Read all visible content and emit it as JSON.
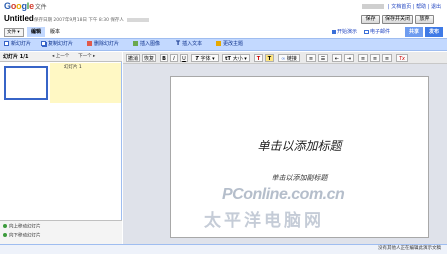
{
  "app": {
    "logo_google": "Google",
    "logo_product": "文件",
    "top_links": [
      "|",
      "文档首页",
      "|",
      "帮助",
      "|",
      "退出"
    ]
  },
  "doc": {
    "title": "Untitled",
    "save_info": "保存日期 2007年9月18日 下午 8:30 保存人"
  },
  "top_buttons": {
    "save": "保存",
    "save_close": "保存并关闭",
    "discard": "放弃"
  },
  "menu": {
    "file": "文件 ▾",
    "tabs": [
      {
        "label": "编辑"
      },
      {
        "label": "版本"
      }
    ],
    "right_items": [
      "开始演示",
      "电子邮件"
    ],
    "share": "共享",
    "publish": "发布"
  },
  "toolbar1": [
    {
      "label": "新幻灯片",
      "icon": "new-slide-icon"
    },
    {
      "label": "复制幻灯片",
      "icon": "copy-slide-icon"
    },
    {
      "label": "删除幻灯片",
      "icon": "delete-slide-icon"
    },
    {
      "label": "插入图像",
      "icon": "insert-image-icon"
    },
    {
      "label": "插入文本",
      "icon": "insert-text-icon"
    },
    {
      "label": "更改主题",
      "icon": "change-theme-icon"
    }
  ],
  "slides_panel": {
    "label": "幻灯片 1/1",
    "prev": "◂ 上一个",
    "next": "下一个 ▸",
    "notes_label": "幻灯片 1",
    "move_up": "向上移动幻灯片",
    "move_down": "向下移动幻灯片"
  },
  "format_toolbar": {
    "undo": "撤消",
    "redo": "恢复",
    "bold": "B",
    "italic": "I",
    "underline": "U",
    "font": "字体 ▾",
    "size": "大小 ▾",
    "text_color": "T",
    "highlight": "T",
    "link": "链接",
    "clear": "Tx"
  },
  "slide": {
    "title_placeholder": "单击以添加标题",
    "subtitle_placeholder": "单击以添加副标题"
  },
  "watermark": {
    "line1": "PConline.com.cn",
    "line2": "太平洋电脑网"
  },
  "status": {
    "text": "没有其他人正在编辑此演示文稿"
  },
  "colors": {
    "accent": "#c3d9ff",
    "share_badge": "#6e9cf0",
    "publish_badge": "#3f7ae6",
    "selected": "#3764c7",
    "notes_bg": "#fff8c4"
  }
}
